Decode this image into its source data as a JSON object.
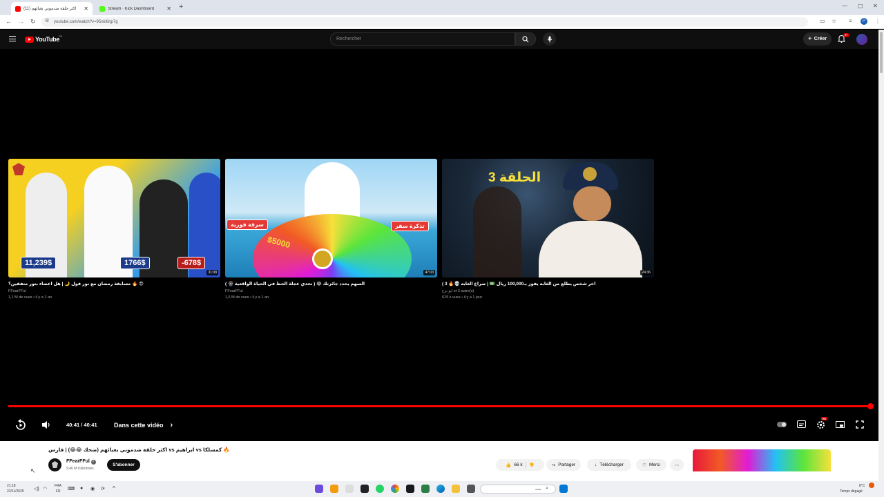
{
  "browser": {
    "tabs": [
      {
        "title": "(11) اكثر حلقة ضدموني بغبائهم",
        "active": true
      },
      {
        "title": "Stream · Kick Dashboard",
        "active": false
      }
    ],
    "url": "youtube.com/watch?v=95nkl6rjp7g",
    "profile_initial": "P"
  },
  "youtube": {
    "logo_text": "YouTube",
    "region": "FR",
    "search_placeholder": "Rechercher",
    "create_label": "Créer",
    "notifications_badge": "9+"
  },
  "end_screen": {
    "videos": [
      {
        "title": "😍 🔥 مسابقة رمضان مع نور فول 🌙 | هل اعضاء بتور متفقين؟",
        "channel": "FFearFFul",
        "meta": "1,1 M de vues • il y a 1 an",
        "duration": "31:08",
        "labels": [
          "11,239$",
          "1766$",
          "-678$"
        ]
      },
      {
        "title": "السهم يحدد جائزتك 😂 ( تحدي عجلة الحظ في الحياة الواقعية 🎡 )",
        "channel": "FFearFFul",
        "meta": "1,6 M de vues • il y a 1 an",
        "duration": "47:03",
        "labels": [
          "$5000",
          "سرقة فورية",
          "تذكرة سفر"
        ]
      },
      {
        "title": "اخر شخص يطلع من الغابه يفوز بـ100,000 ريال 💵 | صراع الغابه 💀🔥 3 )",
        "channel": "ابو نزع et 3 autre(s)",
        "meta": "619 k vues • il y a 1 jour",
        "duration": "24:36",
        "labels": [
          "الحلقة 3"
        ]
      }
    ]
  },
  "player": {
    "time": "40:41 / 40:41",
    "chapter": "Dans cette vidéo",
    "settings_badge": "HD",
    "progress_fraction": 1.0
  },
  "video_info": {
    "title": "🔥 كمسلكا vs ابراهيم vs اكثر حلقة ضدموني بغبائهم (ضحك 😂😂) | فارس",
    "channel": "FFearFFul",
    "subscribers": "9,46 M d'abonnés",
    "subscribe_label": "S'abonner",
    "likes": "66 k",
    "share_label": "Partager",
    "download_label": "Télécharger",
    "thanks_label": "Merci"
  },
  "taskbar": {
    "time": "21:18",
    "date": "22/11/2025",
    "lang_top": "FRA",
    "lang_bottom": "FR",
    "search_placeholder": "بحث",
    "weather_temp": "8°C",
    "weather_desc": "Temps dégagé"
  }
}
